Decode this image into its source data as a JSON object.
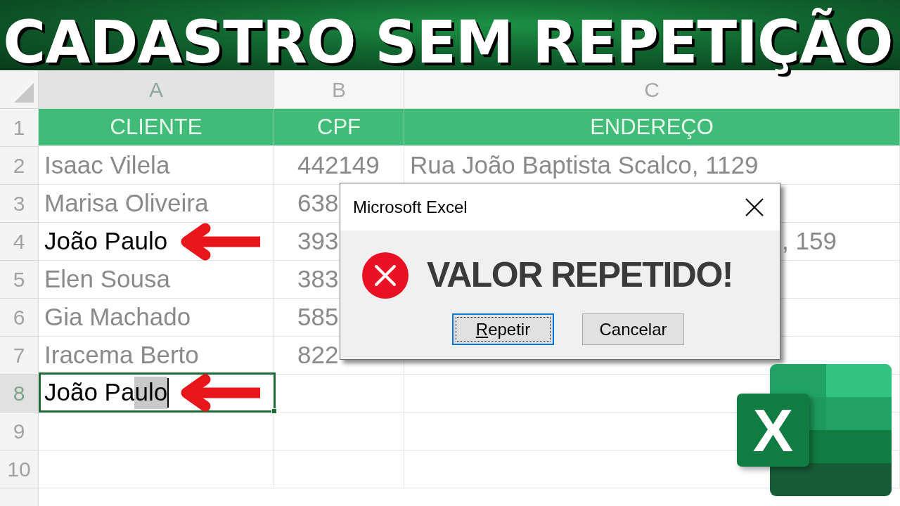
{
  "banner": {
    "title": "CADASTRO SEM REPETIÇÃO"
  },
  "sheet": {
    "columns": [
      {
        "label": "A",
        "selected": true
      },
      {
        "label": "B",
        "selected": false
      },
      {
        "label": "C",
        "selected": false
      }
    ],
    "header_row": {
      "number": "1",
      "cells": [
        "CLIENTE",
        "CPF",
        "ENDEREÇO"
      ]
    },
    "rows": [
      {
        "number": "2",
        "selected": false,
        "arrow": false,
        "cells": [
          {
            "kind": "text",
            "text": "Isaac Vilela",
            "dimmed": true
          },
          {
            "kind": "text",
            "text": "442149",
            "dimmed": true
          },
          {
            "kind": "text",
            "text": "Rua João Baptista Scalco, 1129",
            "dimmed": true
          }
        ]
      },
      {
        "number": "3",
        "selected": false,
        "arrow": false,
        "cells": [
          {
            "kind": "text",
            "text": "Marisa Oliveira",
            "dimmed": true
          },
          {
            "kind": "text",
            "text": "638",
            "dimmed": true
          }
        ]
      },
      {
        "number": "4",
        "selected": false,
        "arrow": true,
        "cells": [
          {
            "kind": "text",
            "text": "João Paulo",
            "dimmed": false
          },
          {
            "kind": "text",
            "text": "393",
            "dimmed": true
          },
          {
            "kind": "clipped",
            "text": ", 159",
            "dimmed": true
          }
        ]
      },
      {
        "number": "5",
        "selected": false,
        "arrow": false,
        "cells": [
          {
            "kind": "text",
            "text": "Elen Sousa",
            "dimmed": true
          },
          {
            "kind": "text",
            "text": "383",
            "dimmed": true
          }
        ]
      },
      {
        "number": "6",
        "selected": false,
        "arrow": false,
        "cells": [
          {
            "kind": "text",
            "text": "Gia Machado",
            "dimmed": true
          },
          {
            "kind": "text",
            "text": "585",
            "dimmed": true
          }
        ]
      },
      {
        "number": "7",
        "selected": false,
        "arrow": false,
        "cells": [
          {
            "kind": "text",
            "text": "Iracema Berto",
            "dimmed": true
          },
          {
            "kind": "text",
            "text": "822",
            "dimmed": true
          }
        ]
      },
      {
        "number": "8",
        "selected": true,
        "arrow": true,
        "cells": [
          {
            "kind": "input",
            "text": "João Pa",
            "suggestion": "ulo",
            "dimmed": false
          }
        ]
      },
      {
        "number": "9",
        "selected": false,
        "arrow": false,
        "cells": []
      },
      {
        "number": "10",
        "selected": false,
        "arrow": false,
        "cells": []
      }
    ]
  },
  "dialog": {
    "title": "Microsoft Excel",
    "message": "VALOR REPETIDO!",
    "buttons": [
      {
        "label": "Repetir",
        "focused": true,
        "mnemonic": true
      },
      {
        "label": "Cancelar",
        "focused": false,
        "mnemonic": false
      }
    ]
  },
  "logo": {
    "letter": "X"
  }
}
